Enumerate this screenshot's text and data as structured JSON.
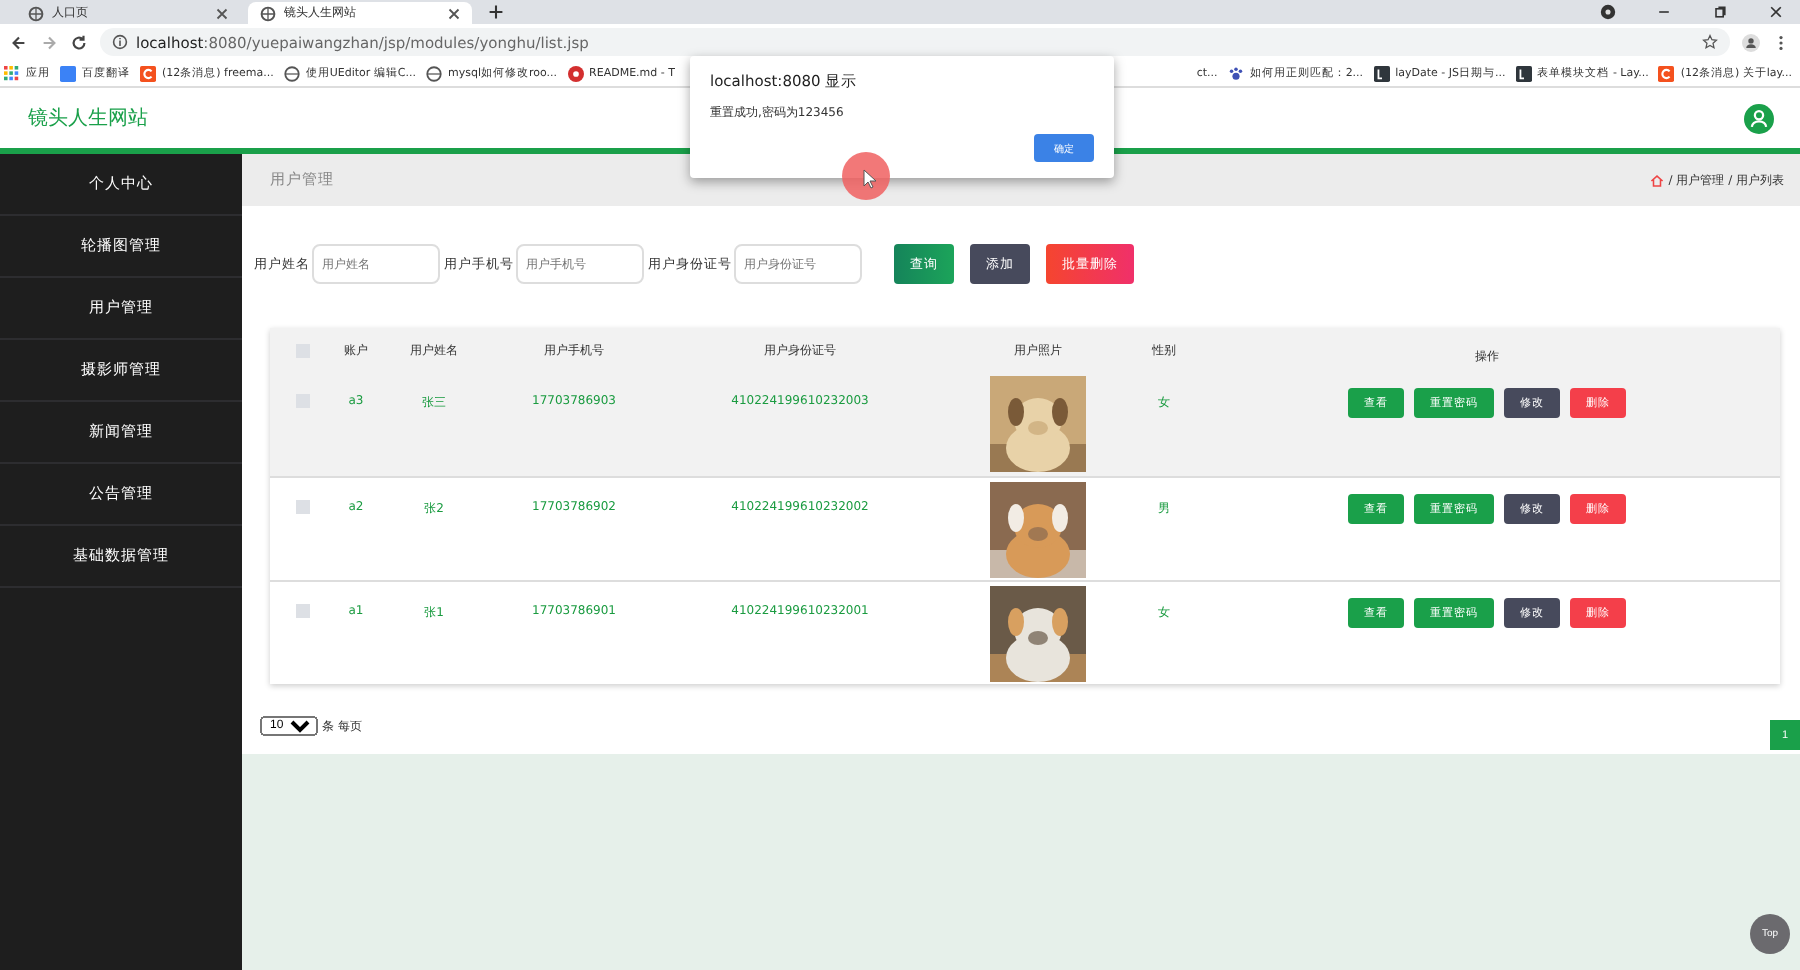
{
  "browser": {
    "tabs": [
      {
        "title": "人口页",
        "selected": false
      },
      {
        "title": "镜头人生网站",
        "selected": true
      }
    ],
    "url_host": "localhost",
    "url_rest": ":8080/yuepaiwangzhan/jsp/modules/yonghu/list.jsp",
    "bookmarks": [
      {
        "label": "应用",
        "kind": "apps"
      },
      {
        "label": "百度翻译",
        "kind": "translate"
      },
      {
        "label": "(12条消息) freema...",
        "kind": "csdn"
      },
      {
        "label": "使用UEditor 编辑C...",
        "kind": "globe"
      },
      {
        "label": "mysql如何修改roo...",
        "kind": "globe"
      },
      {
        "label": "README.md - T",
        "kind": "readme"
      }
    ],
    "bookmarks_right": [
      {
        "label": "ct...",
        "kind": "none"
      },
      {
        "label": "如何用正则匹配：2...",
        "kind": "paw"
      },
      {
        "label": "layDate - JS日期与...",
        "kind": "layui"
      },
      {
        "label": "表单模块文档 - Lay...",
        "kind": "layui"
      },
      {
        "label": "(12条消息) 关于lay...",
        "kind": "csdn"
      }
    ]
  },
  "site": {
    "title": "镜头人生网站"
  },
  "sidebar": {
    "items": [
      {
        "label": "个人中心",
        "selected": false
      },
      {
        "label": "轮播图管理",
        "selected": false
      },
      {
        "label": "用户管理",
        "selected": false
      },
      {
        "label": "摄影师管理",
        "selected": false
      },
      {
        "label": "新闻管理",
        "selected": false
      },
      {
        "label": "公告管理",
        "selected": false
      },
      {
        "label": "基础数据管理",
        "selected": false
      }
    ]
  },
  "breadcrumb": {
    "title": "用户管理",
    "path": "/ 用户管理 / 用户列表"
  },
  "search": {
    "fields": [
      {
        "label": "用户姓名",
        "placeholder": "用户姓名"
      },
      {
        "label": "用户手机号",
        "placeholder": "用户手机号"
      },
      {
        "label": "用户身份证号",
        "placeholder": "用户身份证号"
      }
    ],
    "buttons": [
      {
        "label": "查询",
        "kind": "query"
      },
      {
        "label": "添加",
        "kind": "add"
      },
      {
        "label": "批量删除",
        "kind": "delete"
      }
    ]
  },
  "table": {
    "select_all_checked": false,
    "columns": [
      "账户",
      "用户姓名",
      "用户手机号",
      "用户身份证号",
      "用户照片",
      "性别",
      "操作"
    ],
    "rows": [
      {
        "checked": false,
        "hovered": true,
        "account": "a3",
        "name": "张三",
        "phone": "17703786903",
        "id_card": "410224199610232003",
        "photo": {
          "kind": "picture"
        },
        "gender": "女",
        "actions": [
          "查看",
          "重置密码",
          "修改",
          "删除"
        ]
      },
      {
        "checked": false,
        "hovered": false,
        "account": "a2",
        "name": "张2",
        "phone": "17703786902",
        "id_card": "410224199610232002",
        "photo": {
          "kind": "picture"
        },
        "gender": "男",
        "actions": [
          "查看",
          "重置密码",
          "修改",
          "删除"
        ]
      },
      {
        "checked": false,
        "hovered": false,
        "account": "a1",
        "name": "张1",
        "phone": "17703786901",
        "id_card": "410224199610232001",
        "photo": {
          "kind": "picture"
        },
        "gender": "女",
        "actions": [
          "查看",
          "重置密码",
          "修改",
          "删除"
        ]
      }
    ]
  },
  "pagination": {
    "page_size": "10",
    "page_size_label": "条 每页",
    "pages": [
      {
        "label": "1",
        "selected": true
      }
    ]
  },
  "back_to_top": "Top",
  "dialog": {
    "title": "localhost:8080 显示",
    "message": "重置成功,密码为123456",
    "button": "确定"
  }
}
